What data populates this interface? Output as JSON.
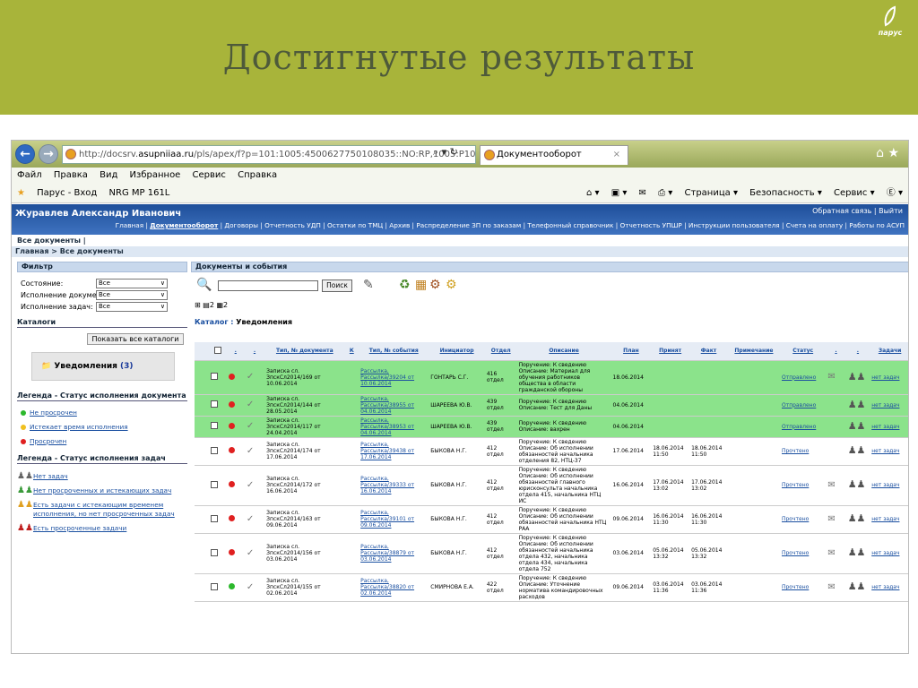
{
  "slide": {
    "title": "Достигнутые результаты",
    "logo_text": "парус"
  },
  "browser": {
    "url_prefix": "http://docsrv.",
    "url_domain": "asupniiaa.ru",
    "url_rest": "/pls/apex/f?p=101:1005:4500627750108035::NO:RP,1005:P1005_WE",
    "url_tools": "⌕ ▾ ↻",
    "tab_title": "Документооборот",
    "tab_close": "×",
    "right_icons": "⌂ ★",
    "menu": [
      "Файл",
      "Правка",
      "Вид",
      "Избранное",
      "Сервис",
      "Справка"
    ],
    "favorites": [
      "Парус - Вход",
      "NRG MP 161L"
    ],
    "commands": [
      "⌂ ▾",
      "▣ ▾",
      "✉",
      "⎙ ▾",
      "Страница ▾",
      "Безопасность ▾",
      "Сервис ▾",
      "Ⓔ ▾"
    ]
  },
  "app": {
    "user": "Журавлев Александр Иванович",
    "feedback": "Обратная связь | Выйти",
    "nav_before": "Главная | ",
    "nav_current": "Документооборот",
    "nav_after": " | Договоры | Отчетность УДП | Остатки по ТМЦ | Архив | Распределение ЗП по заказам | Телефонный справочник | Отчетность УПШР | Инструкции пользователя | Счета на оплату | Работы по АСУП",
    "subbar": "Все документы |",
    "breadcrumb": "Главная > Все документы"
  },
  "filter": {
    "header": "Фильтр",
    "rows": [
      {
        "label": "Состояние:",
        "value": "Все"
      },
      {
        "label": "Исполнение документа:",
        "value": "Все"
      },
      {
        "label": "Исполнение задач:",
        "value": "Все"
      }
    ]
  },
  "catalogs": {
    "header": "Каталоги",
    "show_all": "Показать все каталоги",
    "notif_label": "Уведомления",
    "notif_count": "(3)"
  },
  "legend_doc": {
    "header": "Легенда - Статус исполнения документа",
    "items": [
      {
        "label": "Не просрочен",
        "color": "#2cb82c"
      },
      {
        "label": "Истекает время исполнения",
        "color": "#f0c020"
      },
      {
        "label": "Просрочен",
        "color": "#e02020"
      }
    ]
  },
  "legend_task": {
    "header": "Легенда - Статус исполнения задач",
    "items": [
      {
        "label": "Нет задач"
      },
      {
        "label": "Нет просроченных и истекающих задач"
      },
      {
        "label": "Есть задачи с истекающим временем исполнения, но нет просроченных задач"
      },
      {
        "label": "Есть просроченные задачи"
      }
    ]
  },
  "main": {
    "header": "Документы и события",
    "search_label": "Поиск",
    "tree_counts": [
      "2",
      "2"
    ],
    "catalog_prefix": "Каталог : ",
    "catalog_name": "Уведомления"
  },
  "table": {
    "columns": [
      "",
      "",
      ".",
      ".",
      "Тип, № документа",
      "К",
      "Тип, № события",
      "Инициатор",
      "Отдел",
      "Описание",
      "План",
      "Принят",
      "Факт",
      "Примечание",
      "Статус",
      ".",
      ".",
      "Задачи"
    ],
    "rows": [
      {
        "g": true,
        "dot": "r",
        "doc": "Записка сл. ЗпскСл2014/169 от 10.06.2014",
        "ev": "Рассылка, Рассылка/39204 от 10.06.2014",
        "init": "ГОНТАРЬ С.Г.",
        "dept": "416 отдел",
        "desc": "Поручение: К сведению Описание: Материал для обучения работников общества в области гражданской обороны",
        "plan": "18.06.2014",
        "acc": "",
        "fact": "",
        "status": "Отправлено",
        "clip": true,
        "tasks": "нет задач"
      },
      {
        "g": true,
        "dot": "r",
        "doc": "Записка сл. ЗпскСл2014/144 от 28.05.2014",
        "ev": "Рассылка, Рассылка/38955 от 04.06.2014",
        "init": "ШАРЕЕВА Ю.В.",
        "dept": "439 отдел",
        "desc": "Поручение: К сведению Описание: Тест для Даны",
        "plan": "04.06.2014",
        "acc": "",
        "fact": "",
        "status": "Отправлено",
        "clip": false,
        "tasks": "нет задач"
      },
      {
        "g": true,
        "dot": "r",
        "doc": "Записка сл. ЗпскСл2014/117 от 24.04.2014",
        "ev": "Рассылка, Рассылка/38953 от 04.06.2014",
        "init": "ШАРЕЕВА Ю.В.",
        "dept": "439 отдел",
        "desc": "Поручение: К сведению Описание: вахрен",
        "plan": "04.06.2014",
        "acc": "",
        "fact": "",
        "status": "Отправлено",
        "clip": false,
        "tasks": "нет задач"
      },
      {
        "g": false,
        "dot": "r",
        "doc": "Записка сл. ЗпскСл2014/174 от 17.06.2014",
        "ev": "Рассылка, Рассылка/39438 от 17.06.2014",
        "init": "БЫКОВА Н.Г.",
        "dept": "412 отдел",
        "desc": "Поручение: К сведению Описание: Об исполнении обязанностей начальника отделения 82, НТЦ-37",
        "plan": "17.06.2014",
        "acc": "18.06.2014 11:50",
        "fact": "18.06.2014 11:50",
        "status": "Прочтено",
        "clip": false,
        "tasks": "нет задач"
      },
      {
        "g": false,
        "dot": "r",
        "doc": "Записка сл. ЗпскСл2014/172 от 16.06.2014",
        "ev": "Рассылка, Рассылка/39333 от 16.06.2014",
        "init": "БЫКОВА Н.Г.",
        "dept": "412 отдел",
        "desc": "Поручение: К сведению Описание: Об исполнении обязанностей главного юрисконсульта начальника отдела 415, начальника НТЦ ИС",
        "plan": "16.06.2014",
        "acc": "17.06.2014 13:02",
        "fact": "17.06.2014 13:02",
        "status": "Прочтено",
        "clip": true,
        "tasks": "нет задач"
      },
      {
        "g": false,
        "dot": "r",
        "doc": "Записка сл. ЗпскСл2014/163 от 09.06.2014",
        "ev": "Рассылка, Рассылка/39101 от 09.06.2014",
        "init": "БЫКОВА Н.Г.",
        "dept": "412 отдел",
        "desc": "Поручение: К сведению Описание: Об исполнении обязанностей начальника НТЦ РАА",
        "plan": "09.06.2014",
        "acc": "16.06.2014 11:30",
        "fact": "16.06.2014 11:30",
        "status": "Прочтено",
        "clip": true,
        "tasks": "нет задач"
      },
      {
        "g": false,
        "dot": "r",
        "doc": "Записка сл. ЗпскСл2014/156 от 03.06.2014",
        "ev": "Рассылка, Рассылка/38879 от 03.06.2014",
        "init": "БЫКОВА Н.Г.",
        "dept": "412 отдел",
        "desc": "Поручение: К сведению Описание: Об исполнении обязанностей начальника отдела 432, начальника отдела 434, начальника отдела 752",
        "plan": "03.06.2014",
        "acc": "05.06.2014 13:32",
        "fact": "05.06.2014 13:32",
        "status": "Прочтено",
        "clip": true,
        "tasks": "нет задач"
      },
      {
        "g": false,
        "dot": "g",
        "doc": "Записка сл. ЗпскСл2014/155 от 02.06.2014",
        "ev": "Рассылка, Рассылка/38820 от 02.06.2014",
        "init": "СМИРНОВА Е.А.",
        "dept": "422 отдел",
        "desc": "Поручение: К сведению Описание: Уточнение норматива командировочных расходов",
        "plan": "09.06.2014",
        "acc": "03.06.2014 11:36",
        "fact": "03.06.2014 11:36",
        "status": "Прочтено",
        "clip": true,
        "tasks": "нет задач"
      }
    ]
  }
}
